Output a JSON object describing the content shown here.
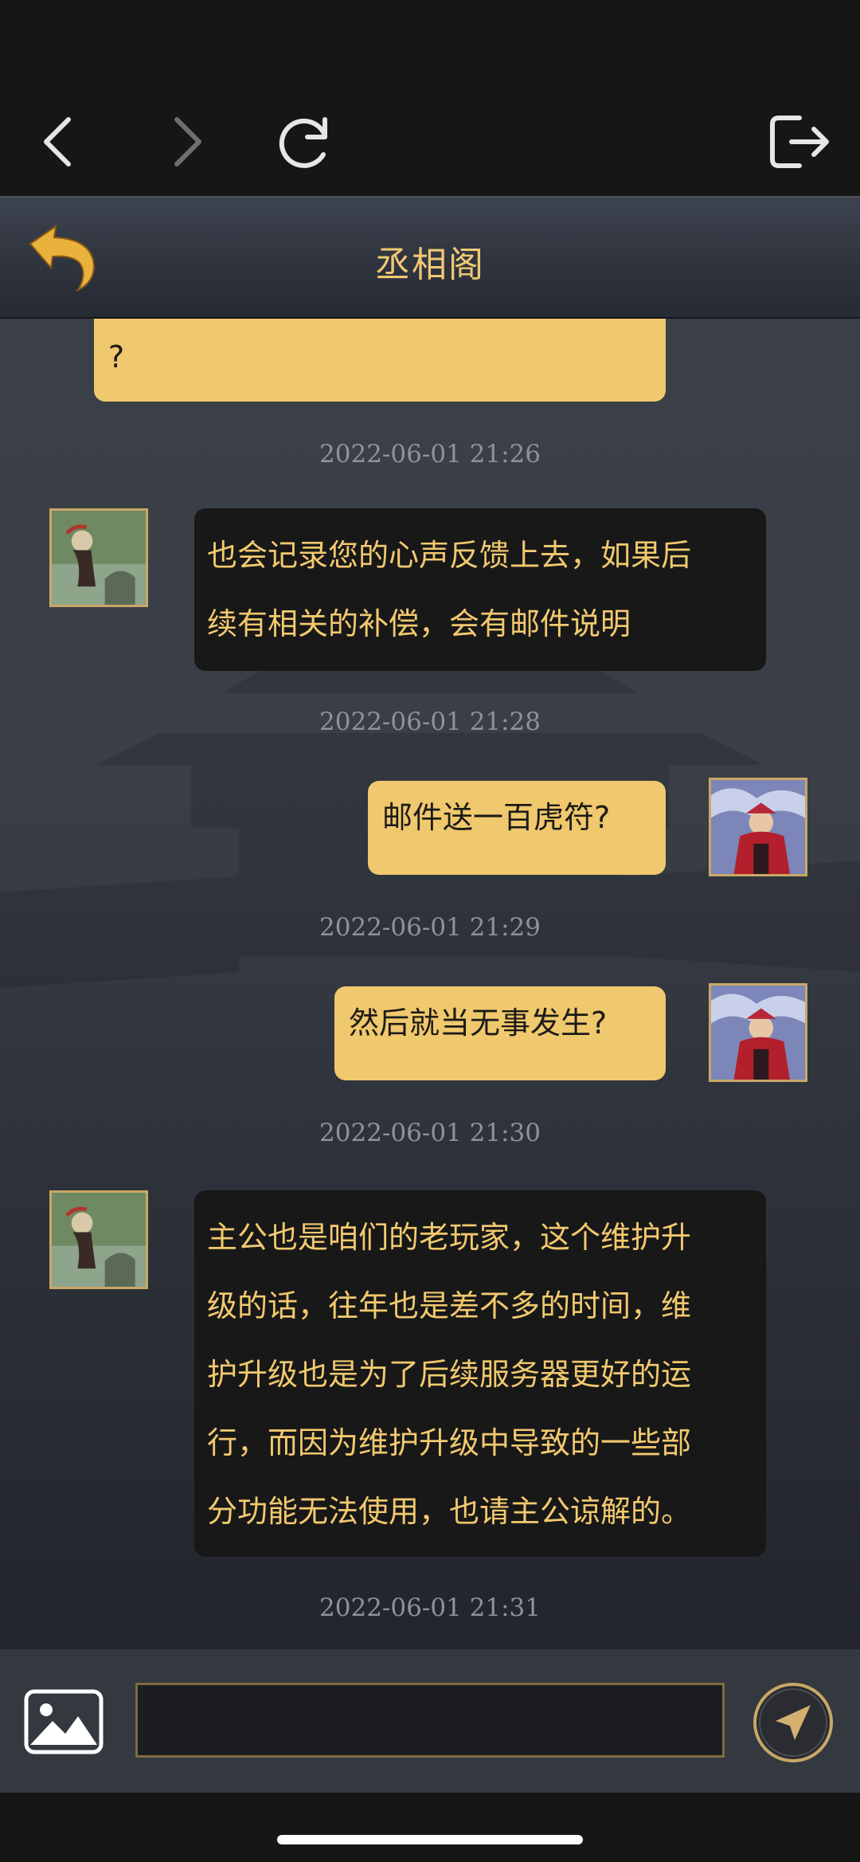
{
  "toolbar": {
    "back": "back-icon",
    "forward": "forward-icon",
    "reload": "reload-icon",
    "exit": "exit-icon"
  },
  "header": {
    "title": "丞相阁",
    "back": "return-arrow-icon"
  },
  "messages": [
    {
      "sender": "me",
      "text": "?"
    },
    {
      "time": "2022-06-01 21:26"
    },
    {
      "sender": "them",
      "lines": [
        "也会记录您的心声反馈上去，如果后",
        "续有相关的补偿，会有邮件说明"
      ]
    },
    {
      "time": "2022-06-01 21:28"
    },
    {
      "sender": "me",
      "text": "邮件送一百虎符?"
    },
    {
      "time": "2022-06-01 21:29"
    },
    {
      "sender": "me",
      "text": "然后就当无事发生?"
    },
    {
      "time": "2022-06-01 21:30"
    },
    {
      "sender": "them",
      "lines": [
        "主公也是咱们的老玩家，这个维护升",
        "级的话，往年也是差不多的时间，维",
        "护升级也是为了后续服务器更好的运",
        "行，而因为维护升级中导致的一些部",
        "分功能无法使用，也请主公谅解的。"
      ]
    },
    {
      "time": "2022-06-01 21:31"
    }
  ],
  "input": {
    "value": "",
    "image_button": "image-icon",
    "send_button": "send-icon"
  },
  "colors": {
    "accent": "#f0c86d",
    "bubble_dark": "#181818",
    "title": "#f0c874"
  }
}
